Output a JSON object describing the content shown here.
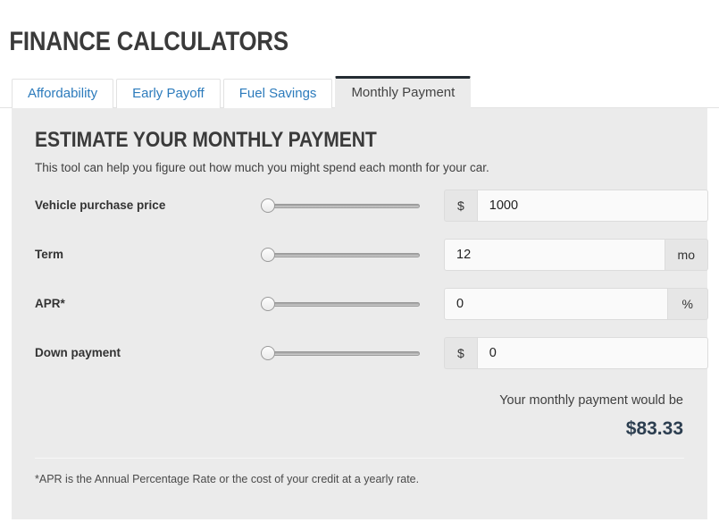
{
  "page": {
    "title": "FINANCE CALCULATORS"
  },
  "tabs": [
    {
      "label": "Affordability",
      "active": false
    },
    {
      "label": "Early Payoff",
      "active": false
    },
    {
      "label": "Fuel Savings",
      "active": false
    },
    {
      "label": "Monthly Payment",
      "active": true
    }
  ],
  "panel": {
    "heading": "ESTIMATE YOUR MONTHLY PAYMENT",
    "subtext": "This tool can help you figure out how much you might spend each month for your car.",
    "fields": [
      {
        "label": "Vehicle purchase price",
        "prefix": "$",
        "suffix": "",
        "value": "1000",
        "slider_position": "0%"
      },
      {
        "label": "Term",
        "prefix": "",
        "suffix": "mo",
        "value": "12",
        "slider_position": "0%"
      },
      {
        "label": "APR*",
        "prefix": "",
        "suffix": "%",
        "value": "0",
        "slider_position": "0%"
      },
      {
        "label": "Down payment",
        "prefix": "$",
        "suffix": "",
        "value": "0",
        "slider_position": "0%"
      }
    ],
    "result": {
      "label": "Your monthly payment would be",
      "amount": "$83.33"
    },
    "footnote": "*APR is the Annual Percentage Rate or the cost of your credit at a yearly rate."
  },
  "colors": {
    "panel_background": "#ebebeb",
    "tab_link": "#2c7bbc",
    "active_tab_border": "#242c33",
    "amount": "#2c3e50"
  }
}
